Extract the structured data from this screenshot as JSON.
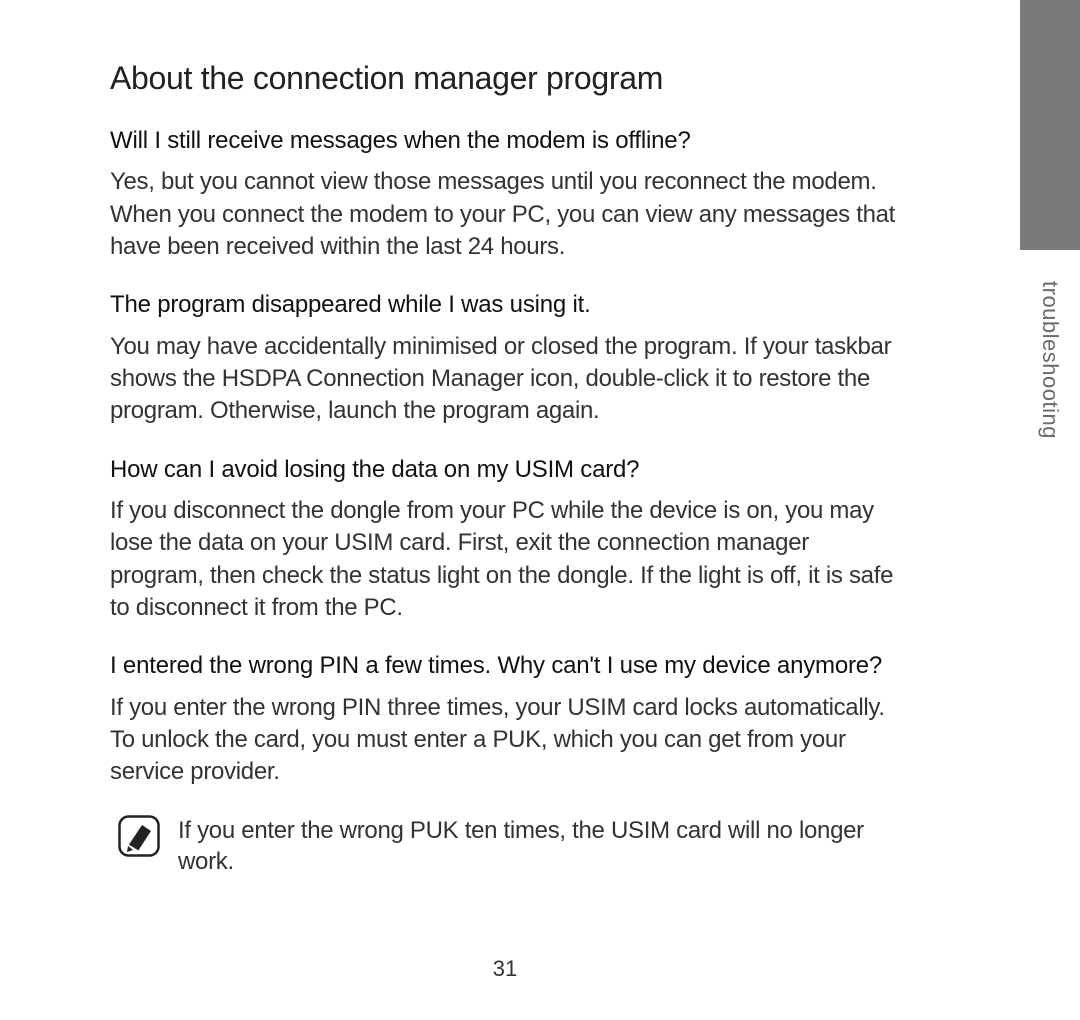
{
  "title": "About the connection manager program",
  "sideTab": "troubleshooting",
  "pageNumber": "31",
  "qa": [
    {
      "q": "Will I still receive messages when the modem is offline?",
      "a": "Yes, but you cannot view those messages until you reconnect the modem. When you connect the modem to your PC, you can view any messages that have been received within the last 24 hours."
    },
    {
      "q": "The program disappeared while I was using it.",
      "a": "You may have accidentally minimised or closed the program. If your taskbar shows the HSDPA Connection Manager icon, double-click it to restore the program. Otherwise, launch the program again."
    },
    {
      "q": "How can I avoid losing the data on my USIM card?",
      "a": "If you disconnect the dongle from your PC while the device is on, you may lose the data on your USIM card. First, exit the connection manager program, then check the status light on the dongle. If the light is off, it is safe to disconnect it from the PC."
    },
    {
      "q": "I entered the wrong PIN a few times. Why can't I use my device anymore?",
      "a": "If you enter the wrong PIN three times, your USIM card locks automatically. To unlock the card, you must enter a PUK, which you can get from your service provider."
    }
  ],
  "note": "If you enter the wrong PUK ten times, the USIM card will no longer work."
}
